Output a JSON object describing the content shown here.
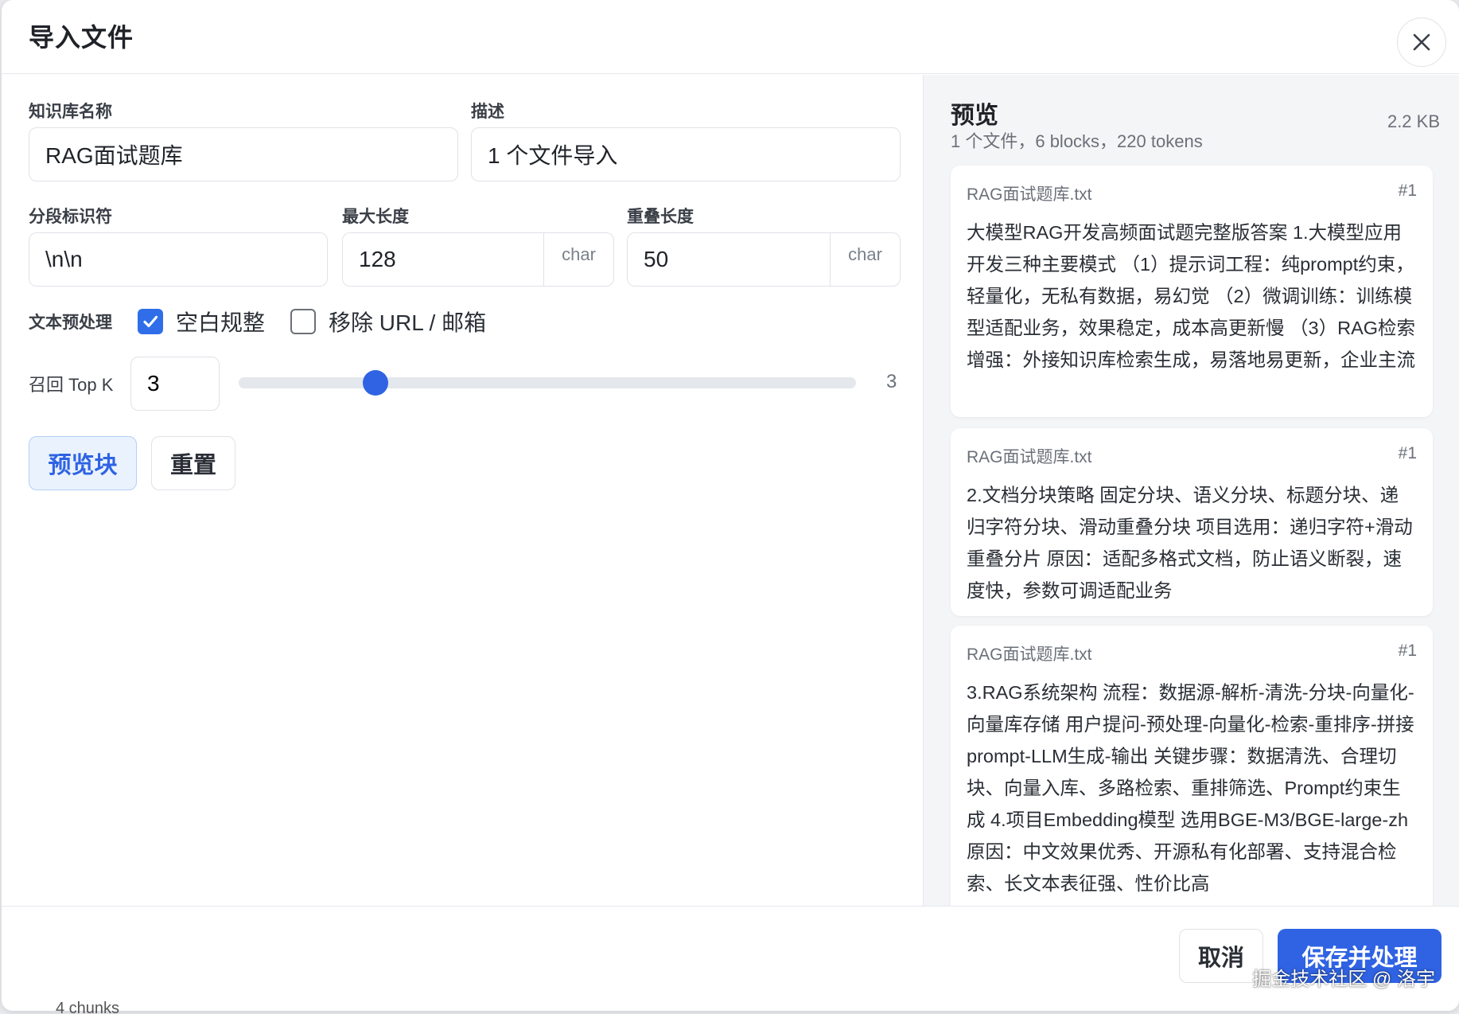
{
  "dialog": {
    "title": "导入文件",
    "close_icon": "close-icon"
  },
  "form": {
    "kb_name_label": "知识库名称",
    "kb_name_value": "RAG面试题库",
    "desc_label": "描述",
    "desc_value": "1 个文件导入",
    "separator_label": "分段标识符",
    "separator_value": "\\n\\n",
    "max_len_label": "最大长度",
    "max_len_value": "128",
    "max_len_unit": "char",
    "overlap_label": "重叠长度",
    "overlap_value": "50",
    "overlap_unit": "char",
    "preprocess_label": "文本预处理",
    "preprocess_options": [
      {
        "label": "空白规整",
        "checked": true
      },
      {
        "label": "移除 URL / 邮箱",
        "checked": false
      }
    ],
    "topk_label": "召回 Top K",
    "topk_value": "3",
    "topk_slider": {
      "min": 1,
      "max": 10,
      "value": 3
    },
    "topk_slider_value_text": "3",
    "preview_button": "预览块",
    "reset_button": "重置"
  },
  "preview": {
    "title": "预览",
    "summary": "1 个文件，6 blocks，220 tokens",
    "size": "2.2 KB",
    "chunks": [
      {
        "file": "RAG面试题库.txt",
        "index": "#1",
        "text": "大模型RAG开发高频面试题完整版答案 1.大模型应用开发三种主要模式 （1）提示词工程：纯prompt约束，轻量化，无私有数据，易幻觉 （2）微调训练：训练模型适配业务，效果稳定，成本高更新慢 （3）RAG检索增强：外接知识库检索生成，易落地易更新，企业主流"
      },
      {
        "file": "RAG面试题库.txt",
        "index": "#1",
        "text": "2.文档分块策略 固定分块、语义分块、标题分块、递归字符分块、滑动重叠分块 项目选用：递归字符+滑动重叠分片 原因：适配多格式文档，防止语义断裂，速度快，参数可调适配业务"
      },
      {
        "file": "RAG面试题库.txt",
        "index": "#1",
        "text": "3.RAG系统架构 流程：数据源-解析-清洗-分块-向量化-向量库存储 用户提问-预处理-向量化-检索-重排序-拼接prompt-LLM生成-输出 关键步骤：数据清洗、合理切块、向量入库、多路检索、重排筛选、Prompt约束生成 4.项目Embedding模型 选用BGE-M3/BGE-large-zh 原因：中文效果优秀、开源私有化部署、支持混合检索、长文本表征强、性价比高"
      }
    ]
  },
  "footer": {
    "cancel_button": "取消",
    "save_button": "保存并处理"
  },
  "watermark": "掘金技术社区 @ 洛宇",
  "backdrop_text": "4 chunks",
  "colors": {
    "primary": "#2f63e3",
    "checkbox": "#2f6ee8",
    "panel_bg": "#f4f5f7"
  }
}
